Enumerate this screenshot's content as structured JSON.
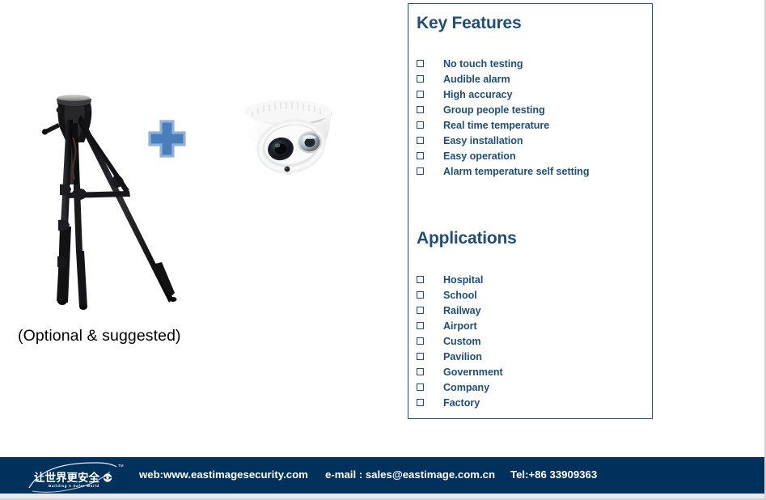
{
  "product": {
    "caption": "(Optional & suggested)",
    "plus_symbol": "+",
    "tripod_alt": "tripod",
    "camera_alt": "dome-camera",
    "plus_color": "#4a7ebb"
  },
  "panel": {
    "border_color": "#1f4e79",
    "accent_color": "#1f4e79",
    "key_features": {
      "heading": "Key Features",
      "items": [
        "No touch testing",
        "Audible alarm",
        "High accuracy",
        "Group people testing",
        "Real time temperature",
        "Easy installation",
        "Easy operation",
        "Alarm temperature self setting"
      ]
    },
    "applications": {
      "heading": "Applications",
      "items": [
        "Hospital",
        "School",
        "Railway",
        "Airport",
        "Custom",
        "Pavilion",
        "Government",
        "Company",
        "Factory"
      ]
    }
  },
  "footer": {
    "background_color": "#00305c",
    "logo": {
      "chinese_text": "让世界更安全",
      "tagline": "Building A Safer World",
      "trademark": "TM"
    },
    "web": "web:www.eastimagesecurity.com",
    "email": "e-mail : sales@eastimage.com.cn",
    "tel": "Tel:+86 33909363"
  }
}
